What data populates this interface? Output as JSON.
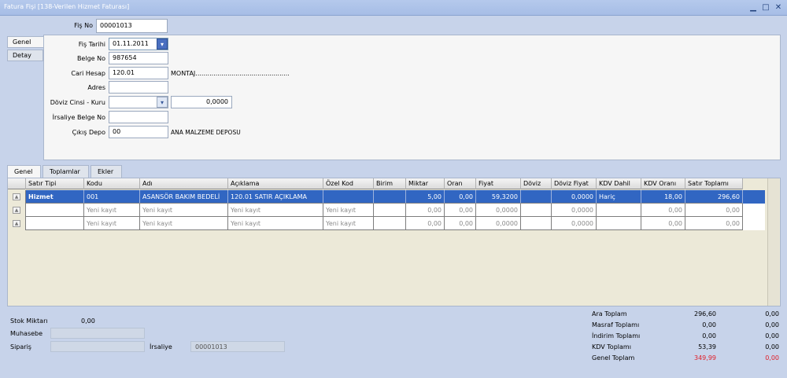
{
  "window": {
    "title": "Fatura Fişi  [138-Verilen Hizmet Faturası]"
  },
  "header": {
    "fis_no_label": "Fiş No",
    "fis_no_value": "00001013",
    "vtabs": [
      "Genel",
      "Detay"
    ],
    "fis_tarihi_label": "Fiş Tarihi",
    "fis_tarihi_value": "01.11.2011",
    "belge_no_label": "Belge No",
    "belge_no_value": "987654",
    "cari_hesap_label": "Cari Hesap",
    "cari_hesap_value": "120.01",
    "cari_hesap_desc": "MONTAJ...............................................",
    "adres_label": "Adres",
    "adres_value": "",
    "doviz_label": "Döviz Cinsi - Kuru",
    "doviz_value": "",
    "kur_value": "0,0000",
    "irsaliye_belge_label": "İrsaliye Belge No",
    "irsaliye_belge_value": "",
    "cikis_depo_label": "Çıkış Depo",
    "cikis_depo_value": "00",
    "cikis_depo_desc": "ANA MALZEME DEPOSU"
  },
  "tabs": [
    "Genel",
    "Toplamlar",
    "Ekler"
  ],
  "grid": {
    "columns": [
      "Satır Tipi",
      "Kodu",
      "Adı",
      "Açıklama",
      "Özel Kod",
      "Birim",
      "Miktar",
      "Oran",
      "Fiyat",
      "Döviz",
      "Döviz Fiyat",
      "KDV Dahil",
      "KDV Oranı",
      "Satır Toplamı"
    ],
    "rows": [
      {
        "satir_tipi": "Hizmet",
        "kodu": "001",
        "adi": "ASANSÖR BAKIM BEDELİ",
        "aciklama": "120.01 SATIR AÇIKLAMA",
        "ozel_kod": "",
        "birim": "",
        "miktar": "5,00",
        "oran": "0,00",
        "fiyat": "59,3200",
        "doviz": "",
        "doviz_fiyat": "0,0000",
        "kdv_dahil": "Hariç",
        "kdv_orani": "18,00",
        "satir_toplami": "296,60"
      },
      {
        "satir_tipi": "",
        "kodu": "Yeni kayıt",
        "adi": "Yeni kayıt",
        "aciklama": "Yeni kayıt",
        "ozel_kod": "Yeni kayıt",
        "birim": "",
        "miktar": "0,00",
        "oran": "0,00",
        "fiyat": "0,0000",
        "doviz": "",
        "doviz_fiyat": "0,0000",
        "kdv_dahil": "",
        "kdv_orani": "0,00",
        "satir_toplami": "0,00"
      },
      {
        "satir_tipi": "",
        "kodu": "Yeni kayıt",
        "adi": "Yeni kayıt",
        "aciklama": "Yeni kayıt",
        "ozel_kod": "Yeni kayıt",
        "birim": "",
        "miktar": "0,00",
        "oran": "0,00",
        "fiyat": "0,0000",
        "doviz": "",
        "doviz_fiyat": "0,0000",
        "kdv_dahil": "",
        "kdv_orani": "0,00",
        "satir_toplami": "0,00"
      }
    ]
  },
  "footer": {
    "stok_miktari_label": "Stok Miktarı",
    "stok_miktari_value": "0,00",
    "muhasebe_label": "Muhasebe",
    "siparis_label": "Sipariş",
    "irsaliye_label": "İrsaliye",
    "irsaliye_value": "00001013"
  },
  "totals": [
    {
      "label": "Ara Toplam",
      "value": "296,60",
      "doviz": "0,00"
    },
    {
      "label": "Masraf Toplamı",
      "value": "0,00",
      "doviz": "0,00"
    },
    {
      "label": "İndirim Toplamı",
      "value": "0,00",
      "doviz": "0,00"
    },
    {
      "label": "KDV Toplamı",
      "value": "53,39",
      "doviz": "0,00"
    },
    {
      "label": "Genel Toplam",
      "value": "349,99",
      "doviz": "0,00"
    }
  ],
  "colors": {
    "selected_row": "#3166c2",
    "genel_toplam": "#e0202a",
    "background": "#c7d3ea"
  }
}
